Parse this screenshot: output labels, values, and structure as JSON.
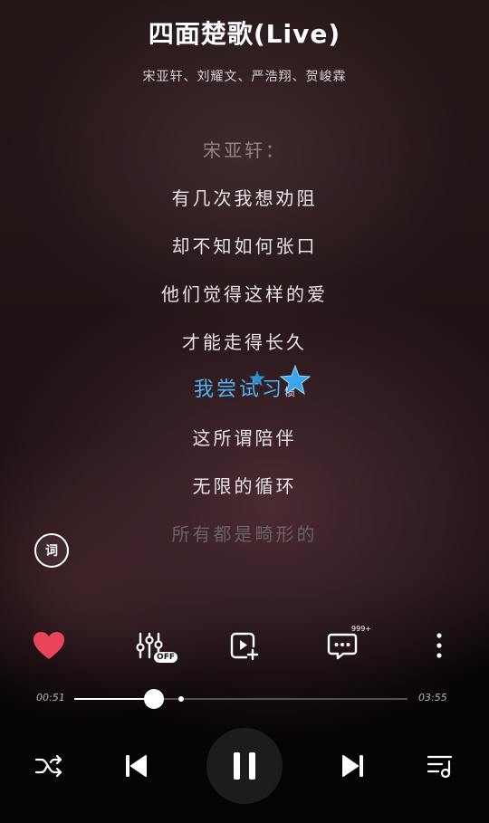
{
  "song": {
    "title": "四面楚歌(Live)",
    "artists": "宋亚轩、刘耀文、严浩翔、贺峻霖"
  },
  "lyrics": [
    {
      "text": "宋亚轩：",
      "state": "dim"
    },
    {
      "text": "有几次我想劝阻",
      "state": "normal"
    },
    {
      "text": "却不知如何张口",
      "state": "normal"
    },
    {
      "text": "他们觉得这样的爱",
      "state": "normal"
    },
    {
      "text": "才能走得长久",
      "state": "normal"
    },
    {
      "text": "我尝试习惯",
      "state": "current"
    },
    {
      "text": "这所谓陪伴",
      "state": "normal"
    },
    {
      "text": "无限的循环",
      "state": "normal"
    },
    {
      "text": "所有都是畸形的",
      "state": "faded"
    }
  ],
  "current_line": {
    "sung": "我尝试习",
    "rest": "惯"
  },
  "lyric_toggle": {
    "label": "词"
  },
  "actions": {
    "like_icon": "heart-icon",
    "like_color": "#e8455a",
    "effects_badge": "OFF",
    "comments_count": "999+"
  },
  "playback": {
    "elapsed": "00:51",
    "duration": "03:55",
    "progress_fraction": 0.24,
    "buffered_fraction": 0.32
  },
  "colors": {
    "accent_lyric": "#4fb4ee",
    "background": "#0b0607"
  }
}
